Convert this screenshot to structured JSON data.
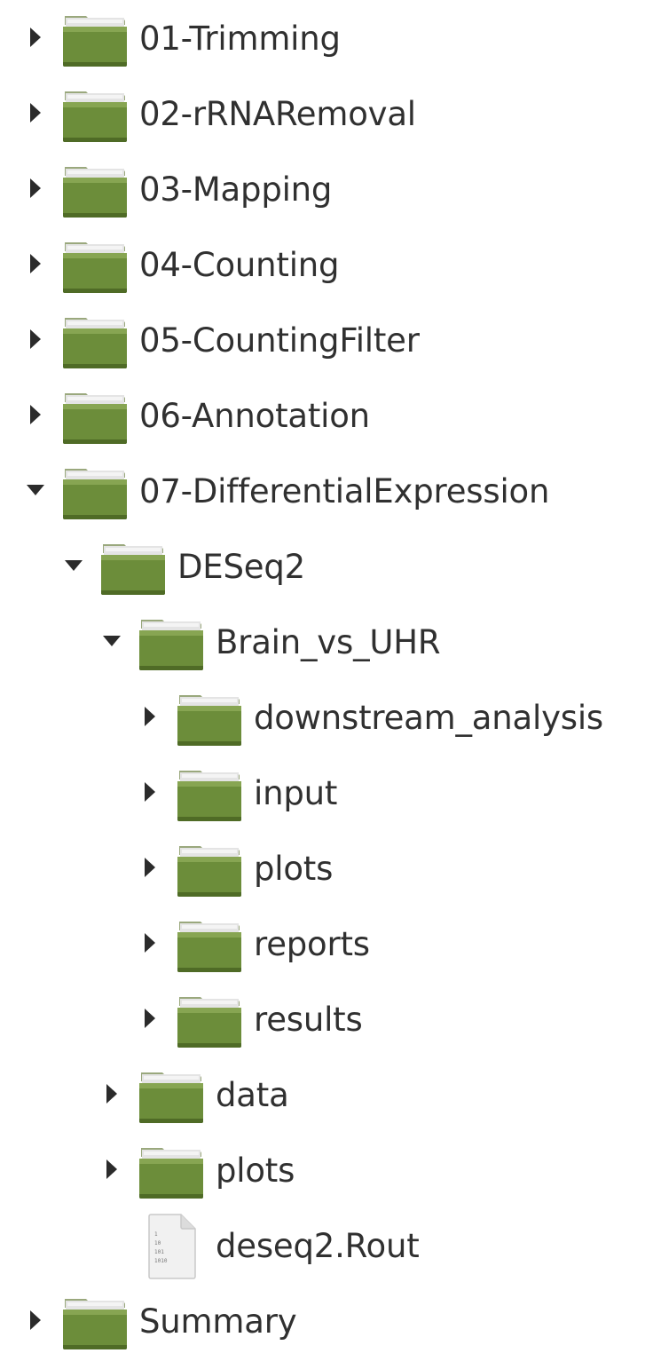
{
  "tree": {
    "items": [
      {
        "label": "01-Trimming",
        "type": "folder",
        "expander": "collapsed",
        "icon": "folder-icon",
        "level": 0
      },
      {
        "label": "02-rRNARemoval",
        "type": "folder",
        "expander": "collapsed",
        "icon": "folder-icon",
        "level": 0
      },
      {
        "label": "03-Mapping",
        "type": "folder",
        "expander": "collapsed",
        "icon": "folder-icon",
        "level": 0
      },
      {
        "label": "04-Counting",
        "type": "folder",
        "expander": "collapsed",
        "icon": "folder-icon",
        "level": 0
      },
      {
        "label": "05-CountingFilter",
        "type": "folder",
        "expander": "collapsed",
        "icon": "folder-icon",
        "level": 0
      },
      {
        "label": "06-Annotation",
        "type": "folder",
        "expander": "collapsed",
        "icon": "folder-icon",
        "level": 0
      },
      {
        "label": "07-DifferentialExpression",
        "type": "folder",
        "expander": "expanded",
        "icon": "folder-icon",
        "level": 0
      },
      {
        "label": "DESeq2",
        "type": "folder",
        "expander": "expanded",
        "icon": "folder-icon",
        "level": 1
      },
      {
        "label": "Brain_vs_UHR",
        "type": "folder",
        "expander": "expanded",
        "icon": "folder-icon",
        "level": 2
      },
      {
        "label": "downstream_analysis",
        "type": "folder",
        "expander": "collapsed",
        "icon": "folder-icon",
        "level": 3
      },
      {
        "label": "input",
        "type": "folder",
        "expander": "collapsed",
        "icon": "folder-icon",
        "level": 3
      },
      {
        "label": "plots",
        "type": "folder",
        "expander": "collapsed",
        "icon": "folder-icon",
        "level": 3
      },
      {
        "label": "reports",
        "type": "folder",
        "expander": "collapsed",
        "icon": "folder-icon",
        "level": 3
      },
      {
        "label": "results",
        "type": "folder",
        "expander": "collapsed",
        "icon": "folder-icon",
        "level": 3
      },
      {
        "label": "data",
        "type": "folder",
        "expander": "collapsed",
        "icon": "folder-icon",
        "level": 2
      },
      {
        "label": "plots",
        "type": "folder",
        "expander": "collapsed",
        "icon": "folder-icon",
        "level": 2
      },
      {
        "label": "deseq2.Rout",
        "type": "file",
        "expander": "none",
        "icon": "binary-file-icon",
        "level": 2
      },
      {
        "label": "Summary",
        "type": "folder",
        "expander": "collapsed",
        "icon": "folder-icon",
        "level": 0
      }
    ]
  },
  "colors": {
    "folder_green": "#6c8d3a",
    "folder_green_dark": "#4f6b26",
    "folder_tab": "#e4e4e4",
    "arrow": "#2b2b2b",
    "text": "#303030"
  }
}
